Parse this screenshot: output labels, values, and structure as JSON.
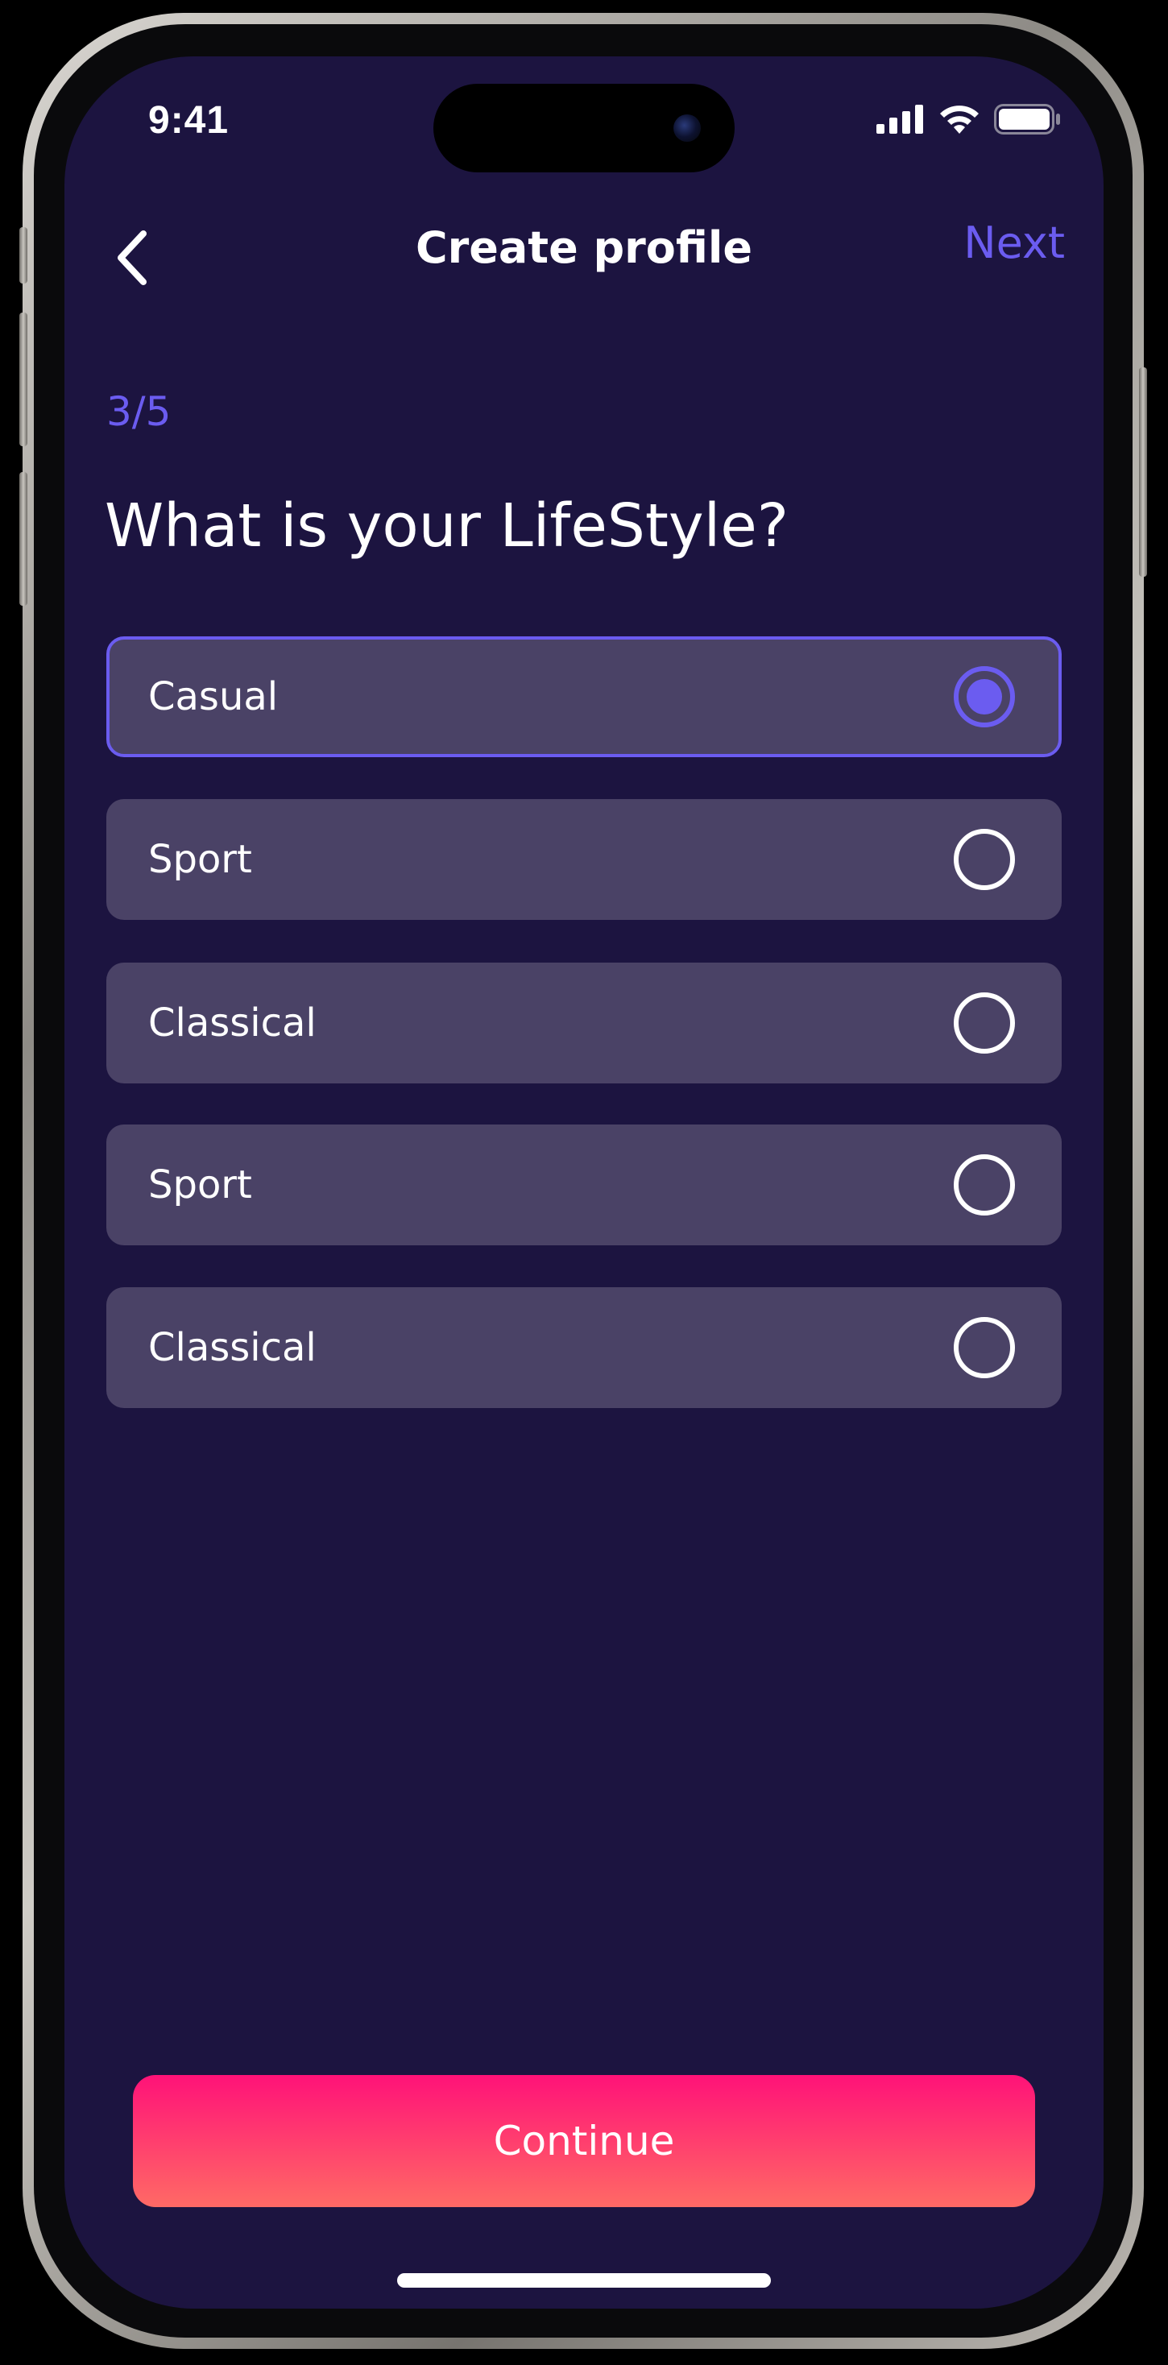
{
  "status_bar": {
    "time": "9:41",
    "icons": [
      "signal-icon",
      "wifi-icon",
      "battery-icon"
    ]
  },
  "nav": {
    "back_icon": "chevron-left-icon",
    "title": "Create profile",
    "next_label": "Next"
  },
  "step": "3/5",
  "question": "What is your LifeStyle?",
  "options": [
    {
      "label": "Casual",
      "selected": true
    },
    {
      "label": "Sport",
      "selected": false
    },
    {
      "label": "Classical",
      "selected": false
    },
    {
      "label": "Sport",
      "selected": false
    },
    {
      "label": "Classical",
      "selected": false
    }
  ],
  "continue_label": "Continue",
  "colors": {
    "background": "#1c1440",
    "accent": "#6b5cf0",
    "option_bg": "#4a4266",
    "button_gradient_top": "#ff1278",
    "button_gradient_bottom": "#ff6a65"
  }
}
